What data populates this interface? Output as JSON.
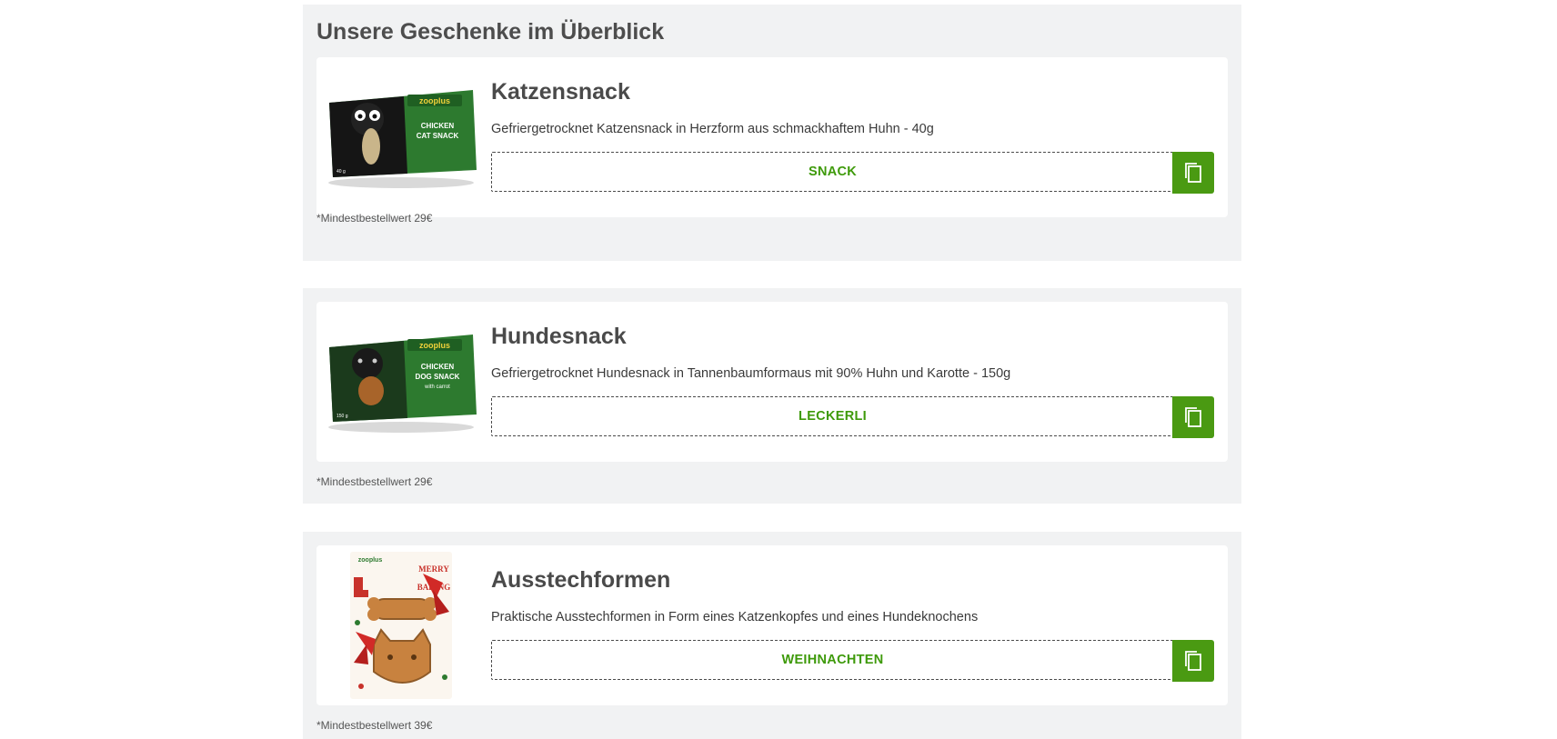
{
  "heading": "Unsere Geschenke im Überblick",
  "colors": {
    "accent": "#4a9a12",
    "code_text": "#3e9a0a",
    "section_bg": "#f1f2f3"
  },
  "gifts": [
    {
      "title": "Katzensnack",
      "description": "Gefriergetrocknet Katzensnack in Herzform aus schmackhaftem Huhn - 40g",
      "code": "SNACK",
      "note": "*Mindestbestellwert 29€",
      "image": {
        "brand": "zooplus",
        "line1": "CHICKEN",
        "line2": "CAT SNACK",
        "weight": "40 g"
      }
    },
    {
      "title": "Hundesnack",
      "description": "Gefriergetrocknet Hundesnack in Tannenbaumformaus mit 90% Huhn und Karotte - 150g",
      "code": "LECKERLI",
      "note": "*Mindestbestellwert 29€",
      "image": {
        "brand": "zooplus",
        "line1": "CHICKEN",
        "line2": "DOG SNACK",
        "line3": "with carrot",
        "weight": "150 g"
      }
    },
    {
      "title": "Ausstechformen",
      "description": "Praktische Ausstechformen in Form eines Katzenkopfes und eines Hundeknochens",
      "code": "WEIHNACHTEN",
      "note": "*Mindestbestellwert 39€",
      "image": {
        "brand": "zooplus",
        "line1": "MERRY",
        "line2": "BAKING"
      }
    }
  ],
  "icons": {
    "copy": "copy-icon"
  }
}
